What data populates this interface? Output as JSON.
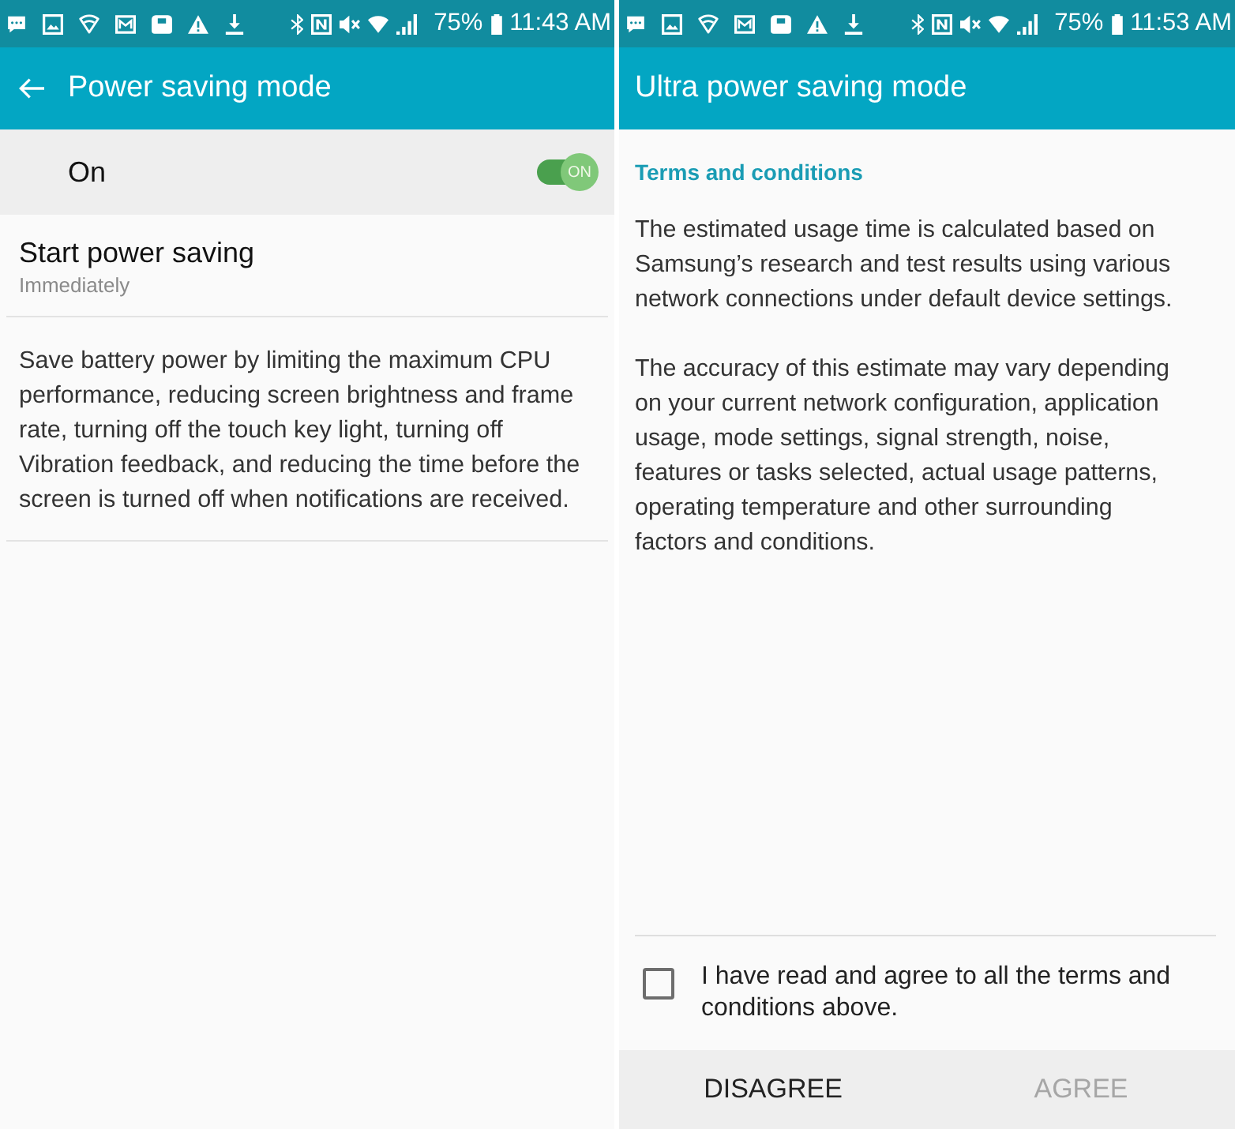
{
  "power_saving_screen": {
    "status_bar": {
      "battery": "75%",
      "time": "11:43 AM"
    },
    "app_bar": {
      "title": "Power saving mode",
      "back": true
    },
    "master_switch": {
      "label": "On",
      "switch_label": "ON",
      "on": true
    },
    "settings": [
      {
        "title": "Start power saving",
        "summary": "Immediately"
      }
    ],
    "description": "Save battery power by limiting the maximum CPU performance, reducing screen brightness and frame rate, turning off the touch key light, turning off Vibration feedback, and reducing the time before the screen is turned off when notifications are received."
  },
  "ultra_power_saving_screen": {
    "status_bar": {
      "battery": "75%",
      "time": "11:53 AM"
    },
    "app_bar": {
      "title": "Ultra power saving mode"
    },
    "section_title": "Terms and conditions",
    "paragraphs": [
      "The estimated usage time is calculated based on Samsung’s research and test results using various network connections under default device settings.",
      "The accuracy of this estimate may vary depending on your current network configuration, application usage, mode settings, signal strength, noise, features or tasks selected, actual usage patterns, operating temperature and other surrounding factors and conditions."
    ],
    "agreement": {
      "label": "I have read and agree to all the terms and conditions above.",
      "checked": false
    },
    "buttons": [
      {
        "label": "DISAGREE",
        "disabled": false
      },
      {
        "label": "AGREE",
        "disabled": true
      }
    ]
  }
}
